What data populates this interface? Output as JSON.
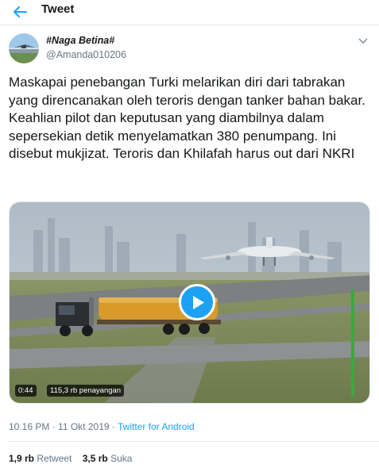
{
  "header": {
    "title": "Tweet",
    "back_icon": "arrow-left-icon",
    "accent": "#1da1f2"
  },
  "author": {
    "display_name": "#Naga Betina#",
    "handle": "@Amanda010206"
  },
  "tweet": {
    "text": "Maskapai penebangan Turki melarikan diri dari tabrakan yang direncanakan oleh teroris dengan tanker bahan bakar. Keahlian pilot dan keputusan yang diambilnya dalam sepersekian detik menyelamatkan 380 penumpang. Ini disebut mukjizat. Teroris dan Khilafah harus out dari NKRI"
  },
  "media": {
    "duration": "0:44",
    "views": "115,3 rb penayangan",
    "play_icon": "play-icon"
  },
  "meta": {
    "time": "10.16 PM",
    "separator1": " · ",
    "date": "11 Okt 2019",
    "separator2": " · ",
    "source": "Twitter for Android"
  },
  "stats": {
    "retweets_count": "1,9 rb",
    "retweets_label": "Retweet",
    "likes_count": "3,5 rb",
    "likes_label": "Suka"
  }
}
